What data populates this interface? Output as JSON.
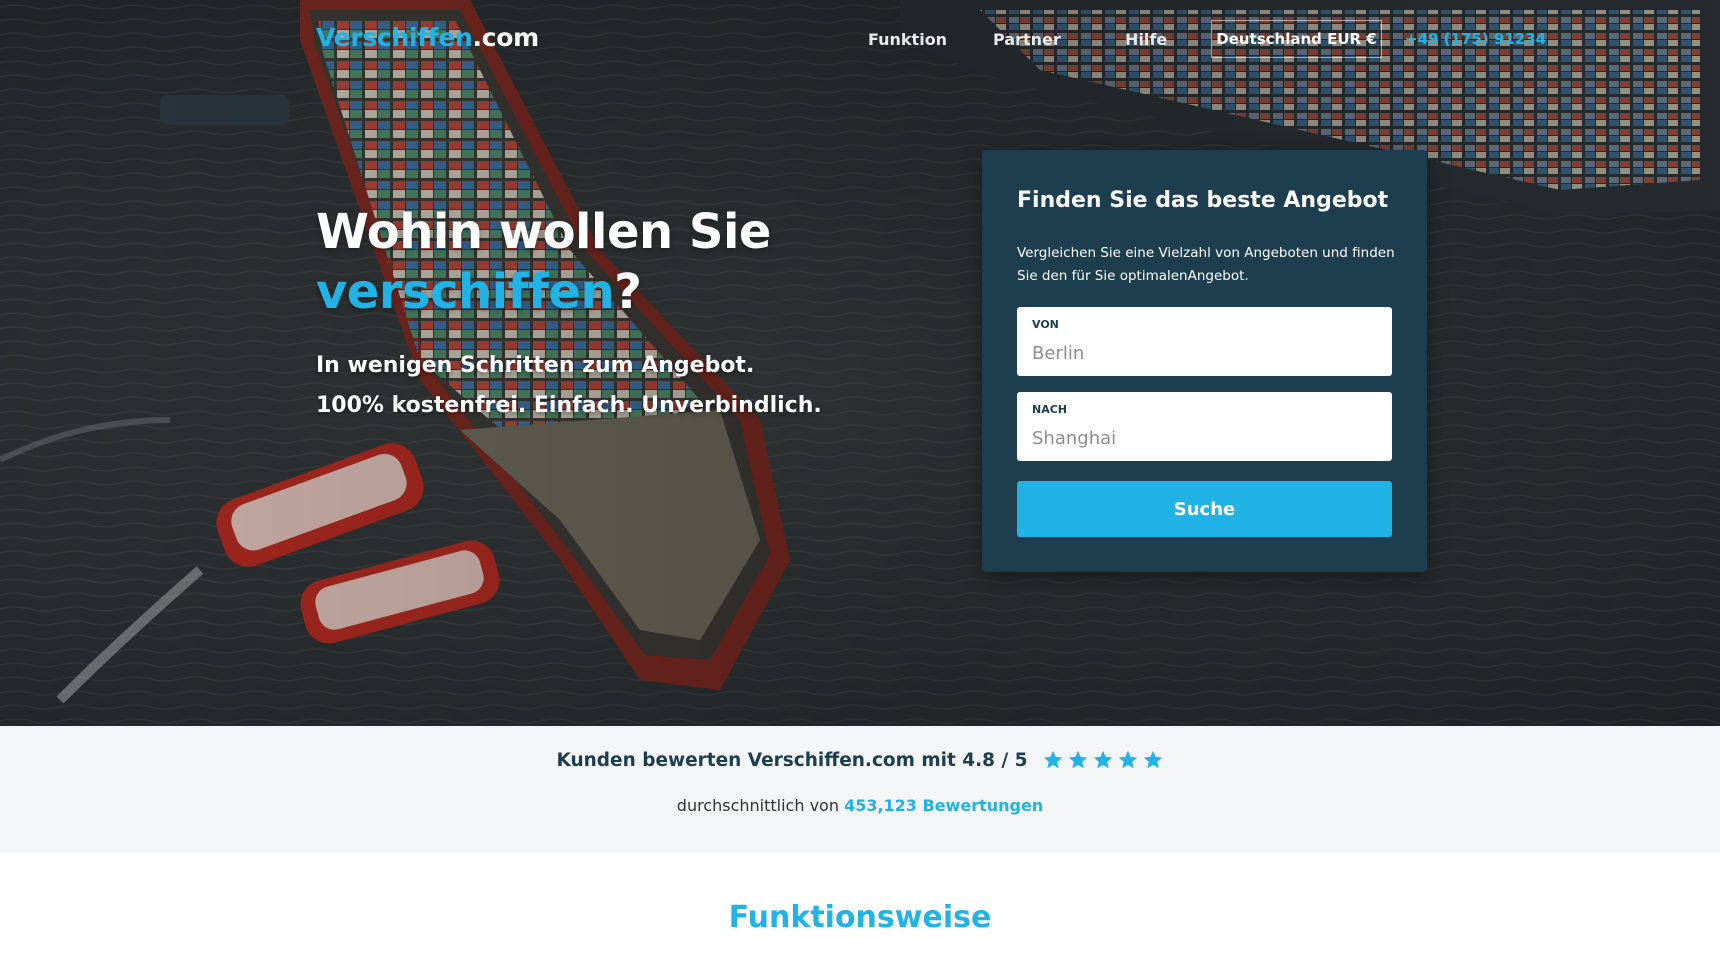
{
  "colors": {
    "accent": "#22b3e6",
    "card_bg": "#1c3e4e",
    "rating_bg": "#f3f5f7"
  },
  "nav": {
    "logo_brand": "Verschiffen",
    "logo_tld": ".com",
    "links": [
      "Funktion",
      "Partner",
      "Hilfe"
    ],
    "country_currency": "Deutschland EUR €",
    "phone": "+49 (175) 91234"
  },
  "hero": {
    "headline_line1": "Wohin wollen Sie",
    "headline_accent": "verschiffen",
    "headline_end": "?",
    "sub_line1": "In wenigen Schritten zum Angebot.",
    "sub_line2": "100% kostenfrei. Einfach. Unverbindlich."
  },
  "search": {
    "title": "Finden Sie das beste Angebot",
    "description": "Vergleichen Sie eine Vielzahl von Angeboten und finden Sie den für Sie optimalenAngebot.",
    "from_label": "VON",
    "from_placeholder": "Berlin",
    "to_label": "NACH",
    "to_placeholder": "Shanghai",
    "button_label": "Suche"
  },
  "rating": {
    "text": "Kunden bewerten Verschiffen.com mit 4.8 / 5",
    "score": 4.8,
    "max": 5,
    "stars_filled": 5,
    "sub_prefix": "durchschnittlich von",
    "sub_link": "453,123 Bewertungen"
  },
  "section": {
    "title": "Funktionsweise"
  }
}
